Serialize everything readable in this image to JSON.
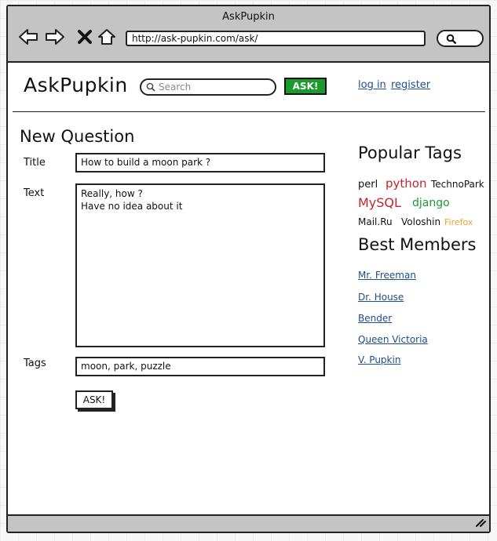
{
  "window": {
    "title": "AskPupkin",
    "url": "http://ask-pupkin.com/ask/"
  },
  "nav_icons": [
    "back-arrow-icon",
    "forward-arrow-icon",
    "stop-x-icon",
    "home-icon"
  ],
  "header": {
    "logo": "AskPupkin",
    "search_placeholder": "Search",
    "ask_button": "ASK!",
    "login": "log in",
    "register": "register",
    "accent_color": "#1a9b2c"
  },
  "form": {
    "heading": "New Question",
    "title_label": "Title",
    "title_value": "How to build a moon park ?",
    "text_label": "Text",
    "text_value": "Really, how ?\nHave no idea about it",
    "tags_label": "Tags",
    "tags_value": "moon, park, puzzle",
    "submit_label": "ASK!"
  },
  "sidebar": {
    "tags_heading": "Popular Tags",
    "tags": [
      {
        "label": "perl",
        "color": "#111111"
      },
      {
        "label": "python",
        "color": "#c0262d"
      },
      {
        "label": "TechnoPark",
        "color": "#111111"
      },
      {
        "label": "MySQL",
        "color": "#c0262d"
      },
      {
        "label": "django",
        "color": "#1a9b2c"
      },
      {
        "label": "Mail.Ru",
        "color": "#111111"
      },
      {
        "label": "Voloshin",
        "color": "#111111"
      },
      {
        "label": "Firefox",
        "color": "#f0a12a"
      }
    ],
    "members_heading": "Best Members",
    "members": [
      "Mr. Freeman",
      "Dr. House",
      "Bender",
      "Queen Victoria",
      "V. Pupkin"
    ]
  }
}
